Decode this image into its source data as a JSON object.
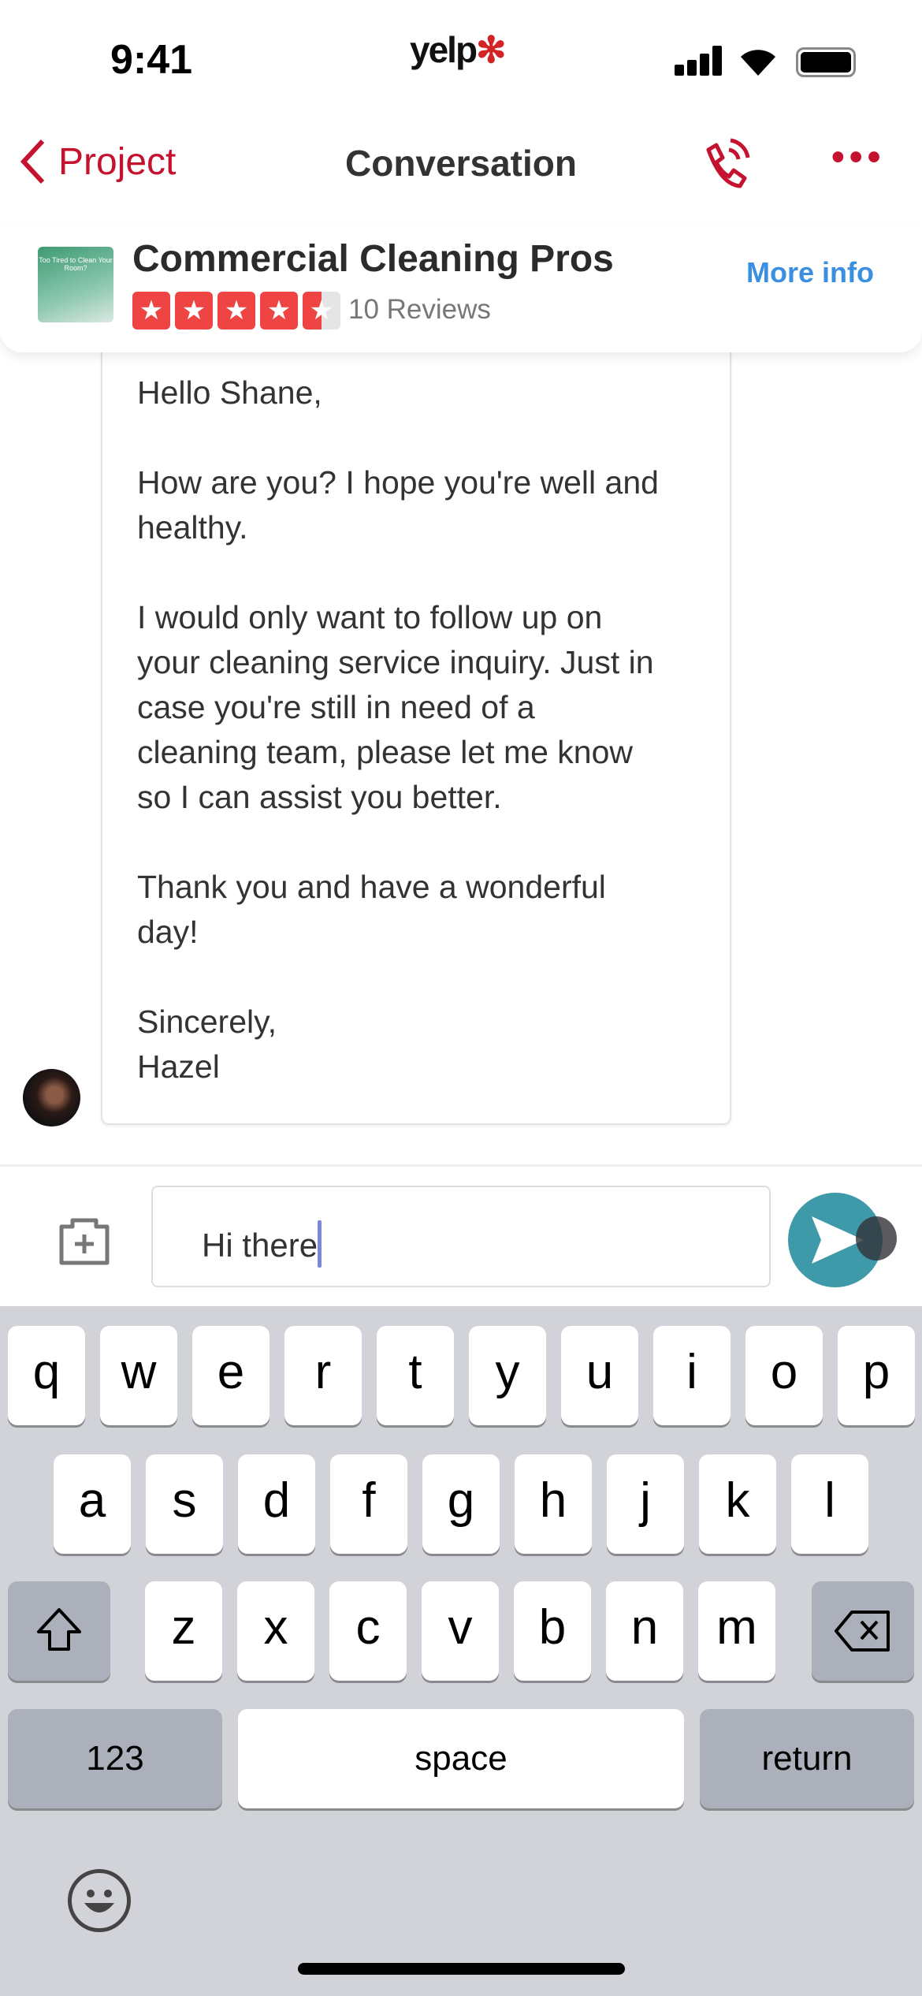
{
  "status_bar": {
    "time": "9:41",
    "carrier_logo": "yelp"
  },
  "nav": {
    "back_label": "Project",
    "title": "Conversation",
    "call_icon": "phone-call-icon",
    "more_icon": "more-dots-icon"
  },
  "business": {
    "name": "Commercial Cleaning Pros",
    "rating": 4.5,
    "reviews": "10 Reviews",
    "more_info": "More info",
    "thumbnail_text": "Too Tired to Clean Your Room?",
    "star_color": "#ef4444"
  },
  "message": {
    "paragraphs": [
      [
        "Hello Shane,"
      ],
      [
        "How are you? I hope you're well and",
        "healthy."
      ],
      [
        "I would only want to follow up on",
        "your cleaning service inquiry. Just in",
        "case you're still in need of a",
        "cleaning team, please let me know",
        "so I can assist you better."
      ],
      [
        "Thank you and have a wonderful",
        "day!"
      ],
      [
        "Sincerely,",
        "Hazel"
      ]
    ]
  },
  "composer": {
    "value": "Hi there",
    "attach_icon": "camera-plus-icon",
    "send_icon": "send-icon",
    "send_color": "#3e9aa8"
  },
  "keyboard": {
    "row1": [
      "q",
      "w",
      "e",
      "r",
      "t",
      "y",
      "u",
      "i",
      "o",
      "p"
    ],
    "row2": [
      "a",
      "s",
      "d",
      "f",
      "g",
      "h",
      "j",
      "k",
      "l"
    ],
    "row3": [
      "z",
      "x",
      "c",
      "v",
      "b",
      "n",
      "m"
    ],
    "numbers": "123",
    "space": "space",
    "return": "return"
  }
}
